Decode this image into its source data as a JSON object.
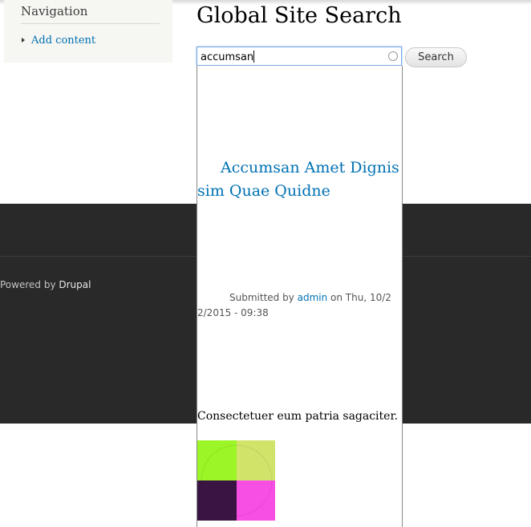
{
  "sidebar": {
    "title": "Navigation",
    "links": [
      {
        "label": "Add content"
      }
    ]
  },
  "main": {
    "page_title": "Global Site Search",
    "search": {
      "value": "accumsan",
      "button_label": "Search"
    }
  },
  "autocomplete": {
    "result_title": "Accumsan Amet Dignissim Quae Quidne",
    "submitted_prefix": "Submitted by ",
    "author": "admin",
    "submitted_suffix": " on Thu, 10/22/2015 - 09:38",
    "teaser": "Consectetuer eum patria sagaciter.",
    "thumbnail_colors": [
      "#9cf526",
      "#d2e36a",
      "#3a1543",
      "#f74ee3"
    ]
  },
  "footer": {
    "powered_prefix": "Powered by ",
    "powered_brand": "Drupal"
  },
  "colors": {
    "link": "#0071b3",
    "footer_bg": "#292929",
    "sidebar_bg": "#f6f6f2"
  }
}
